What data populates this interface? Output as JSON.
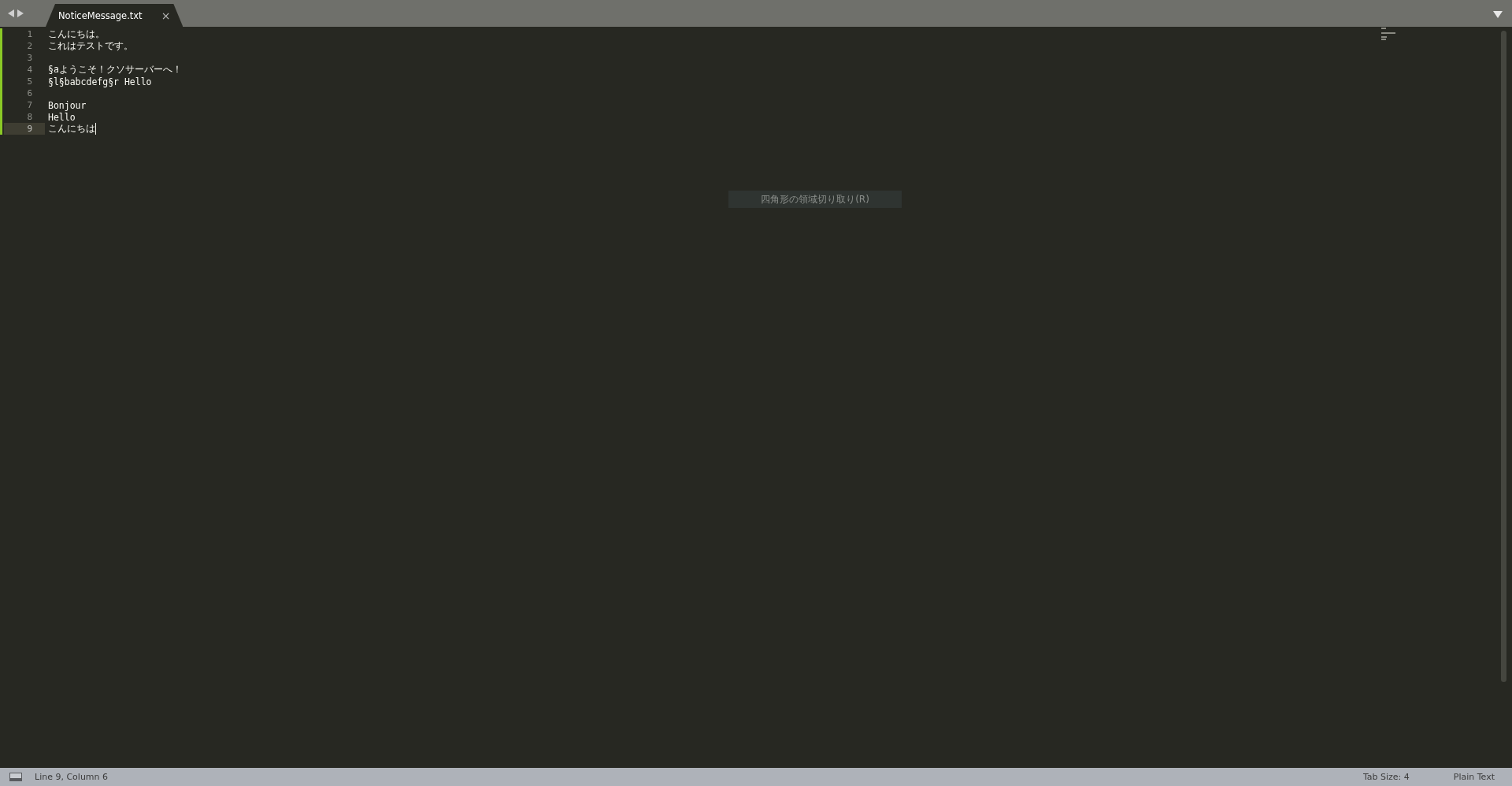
{
  "tabs": [
    {
      "title": "NoticeMessage.txt",
      "selected": true
    }
  ],
  "close_symbol": "×",
  "lines": [
    {
      "number": "1",
      "text": "こんにちは。",
      "modified": true,
      "current": false
    },
    {
      "number": "2",
      "text": "これはテストです。",
      "modified": true,
      "current": false
    },
    {
      "number": "3",
      "modified": true,
      "current": false
    },
    {
      "number": "4",
      "text": "§aようこそ！クソサーバーへ！",
      "modified": true,
      "current": false
    },
    {
      "number": "5",
      "text": "§l§babcdefg§r Hello",
      "modified": true,
      "current": false
    },
    {
      "number": "6",
      "modified": true,
      "current": false
    },
    {
      "number": "7",
      "text": "Bonjour",
      "modified": true,
      "current": false
    },
    {
      "number": "8",
      "text": "Hello",
      "modified": true,
      "current": false
    },
    {
      "number": "9",
      "text": "こんにちは",
      "modified": true,
      "current": true
    }
  ],
  "overlay_tooltip": "四角形の領域切り取り(R)",
  "status_bar": {
    "position": "Line 9, Column 6",
    "tab_size": "Tab Size: 4",
    "syntax": "Plain Text"
  }
}
